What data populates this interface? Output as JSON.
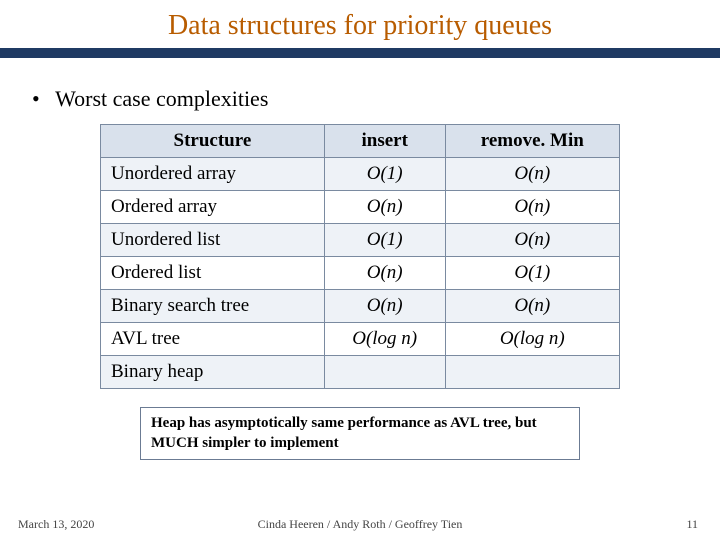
{
  "title": "Data structures for priority queues",
  "bullet": "Worst case complexities",
  "table": {
    "headers": {
      "structure": "Structure",
      "insert": "insert",
      "remove": "remove. Min"
    },
    "rows": [
      {
        "structure": "Unordered array",
        "insert": "O(1)",
        "remove": "O(n)"
      },
      {
        "structure": "Ordered array",
        "insert": "O(n)",
        "remove": "O(n)"
      },
      {
        "structure": "Unordered list",
        "insert": "O(1)",
        "remove": "O(n)"
      },
      {
        "structure": "Ordered list",
        "insert": "O(n)",
        "remove": "O(1)"
      },
      {
        "structure": "Binary search tree",
        "insert": "O(n)",
        "remove": "O(n)"
      },
      {
        "structure": "AVL tree",
        "insert": "O(log n)",
        "remove": "O(log n)"
      },
      {
        "structure": "Binary heap",
        "insert": "",
        "remove": ""
      }
    ]
  },
  "note": "Heap has asymptotically same performance as AVL tree, but MUCH simpler to implement",
  "footer": {
    "date": "March 13, 2020",
    "authors": "Cinda Heeren / Andy Roth / Geoffrey Tien",
    "pagenum": "11"
  },
  "chart_data": {
    "type": "table",
    "title": "Worst case complexities",
    "columns": [
      "Structure",
      "insert",
      "removeMin"
    ],
    "rows": [
      [
        "Unordered array",
        "O(1)",
        "O(n)"
      ],
      [
        "Ordered array",
        "O(n)",
        "O(n)"
      ],
      [
        "Unordered list",
        "O(1)",
        "O(n)"
      ],
      [
        "Ordered list",
        "O(n)",
        "O(1)"
      ],
      [
        "Binary search tree",
        "O(n)",
        "O(n)"
      ],
      [
        "AVL tree",
        "O(log n)",
        "O(log n)"
      ],
      [
        "Binary heap",
        null,
        null
      ]
    ]
  }
}
